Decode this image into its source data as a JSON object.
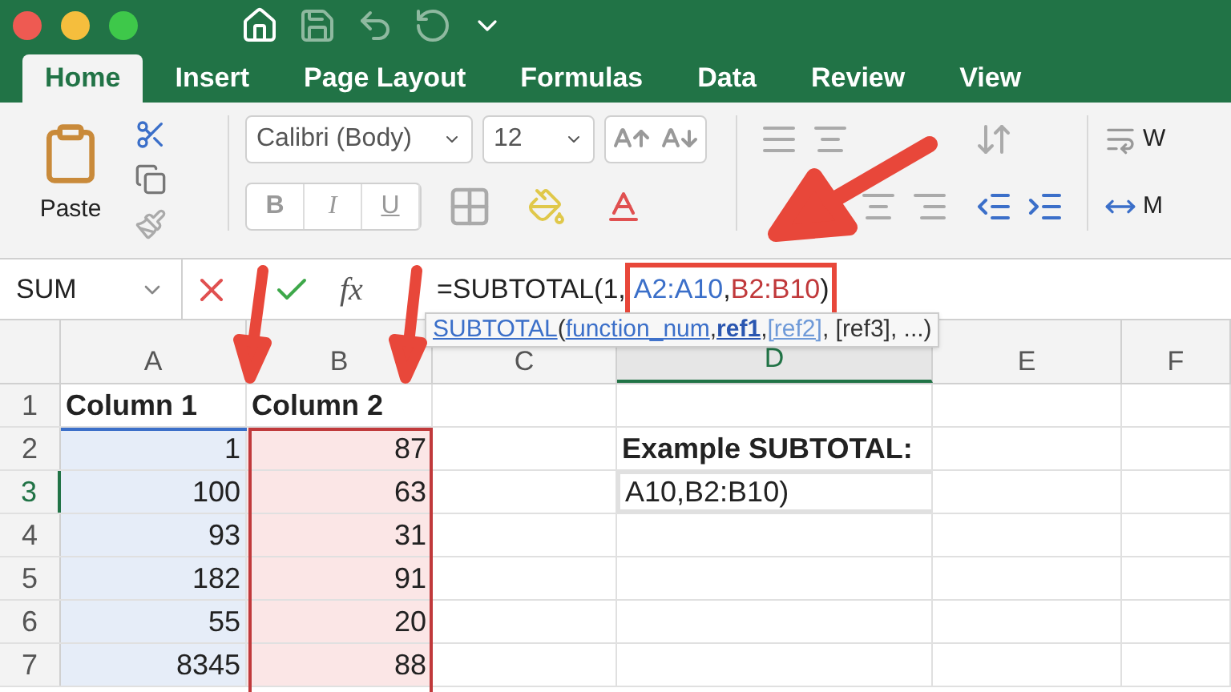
{
  "window": {
    "traffic_lights": [
      {
        "color": "#ee5a52"
      },
      {
        "color": "#f5be3d"
      },
      {
        "color": "#3ec84a"
      }
    ]
  },
  "tabs": [
    {
      "label": "Home",
      "selected": true
    },
    {
      "label": "Insert",
      "selected": false
    },
    {
      "label": "Page Layout",
      "selected": false
    },
    {
      "label": "Formulas",
      "selected": false
    },
    {
      "label": "Data",
      "selected": false
    },
    {
      "label": "Review",
      "selected": false
    },
    {
      "label": "View",
      "selected": false
    }
  ],
  "ribbon": {
    "paste_label": "Paste",
    "font_name": "Calibri (Body)",
    "font_size": "12",
    "format_buttons": [
      "B",
      "I",
      "U"
    ],
    "wrap_label": "W",
    "merge_label": "M"
  },
  "formula_bar": {
    "name_box": "SUM",
    "function_label": "fx",
    "segments": [
      {
        "text": "=SUBTOTAL(1,",
        "color": "#222222"
      }
    ],
    "highlighted_segments": [
      {
        "text": "A2:A10",
        "color": "#3b6fc9"
      },
      {
        "text": ",",
        "color": "#222222"
      },
      {
        "text": "B2:B10",
        "color": "#c0393b"
      },
      {
        "text": ")",
        "color": "#222222"
      }
    ]
  },
  "tooltip": [
    {
      "text": "SUBTOTAL",
      "kind": "link"
    },
    {
      "text": "(",
      "kind": "text"
    },
    {
      "text": "function_num",
      "kind": "link"
    },
    {
      "text": ", ",
      "kind": "text"
    },
    {
      "text": "ref1",
      "kind": "current"
    },
    {
      "text": ", ",
      "kind": "text"
    },
    {
      "text": "[ref2]",
      "kind": "optional"
    },
    {
      "text": ", [ref3], ...)",
      "kind": "text"
    }
  ],
  "sheet": {
    "columns": [
      {
        "label": "A",
        "selected": false
      },
      {
        "label": "B",
        "selected": false
      },
      {
        "label": "C",
        "selected": false
      },
      {
        "label": "D",
        "selected": true
      },
      {
        "label": "E",
        "selected": false
      },
      {
        "label": "F",
        "selected": false
      }
    ],
    "rows": [
      {
        "number": "1",
        "selected": false,
        "cells": [
          {
            "kind": "header",
            "text": "Column 1"
          },
          {
            "kind": "header",
            "text": "Column 2"
          },
          {
            "kind": "empty"
          },
          {
            "kind": "empty"
          },
          {
            "kind": "empty"
          },
          {
            "kind": "empty"
          }
        ]
      },
      {
        "number": "2",
        "selected": false,
        "cells": [
          {
            "kind": "ref_blue",
            "text": "1"
          },
          {
            "kind": "ref_red",
            "text": "87"
          },
          {
            "kind": "empty"
          },
          {
            "kind": "header",
            "text": "Example SUBTOTAL:"
          },
          {
            "kind": "empty"
          },
          {
            "kind": "empty"
          }
        ]
      },
      {
        "number": "3",
        "selected": true,
        "cells": [
          {
            "kind": "ref_blue",
            "text": "100"
          },
          {
            "kind": "ref_red",
            "text": "63"
          },
          {
            "kind": "empty"
          },
          {
            "kind": "active",
            "text": "A10,B2:B10)"
          },
          {
            "kind": "empty"
          },
          {
            "kind": "empty"
          }
        ]
      },
      {
        "number": "4",
        "selected": false,
        "cells": [
          {
            "kind": "ref_blue",
            "text": "93"
          },
          {
            "kind": "ref_red",
            "text": "31"
          },
          {
            "kind": "empty"
          },
          {
            "kind": "empty"
          },
          {
            "kind": "empty"
          },
          {
            "kind": "empty"
          }
        ]
      },
      {
        "number": "5",
        "selected": false,
        "cells": [
          {
            "kind": "ref_blue",
            "text": "182"
          },
          {
            "kind": "ref_red",
            "text": "91"
          },
          {
            "kind": "empty"
          },
          {
            "kind": "empty"
          },
          {
            "kind": "empty"
          },
          {
            "kind": "empty"
          }
        ]
      },
      {
        "number": "6",
        "selected": false,
        "cells": [
          {
            "kind": "ref_blue",
            "text": "55"
          },
          {
            "kind": "ref_red",
            "text": "20"
          },
          {
            "kind": "empty"
          },
          {
            "kind": "empty"
          },
          {
            "kind": "empty"
          },
          {
            "kind": "empty"
          }
        ]
      },
      {
        "number": "7",
        "selected": false,
        "cells": [
          {
            "kind": "ref_blue",
            "text": "8345"
          },
          {
            "kind": "ref_red",
            "text": "88"
          },
          {
            "kind": "empty"
          },
          {
            "kind": "empty"
          },
          {
            "kind": "empty"
          },
          {
            "kind": "empty"
          }
        ]
      }
    ]
  }
}
